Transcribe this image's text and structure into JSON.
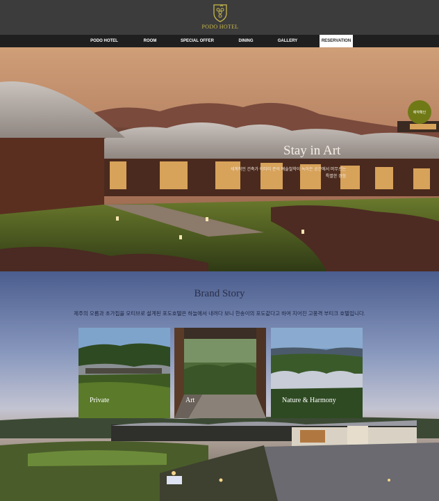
{
  "header": {
    "logo_text": "PODO HOTEL"
  },
  "nav": {
    "items": [
      "PODO HOTEL",
      "ROOM",
      "SPECIAL OFFER",
      "DINING",
      "GALLERY",
      "RESERVATION"
    ],
    "active": "RESERVATION"
  },
  "hero": {
    "title": "Stay in Art",
    "subtitle": "세계적인 건축가 이타미 준의 예술철학이 녹아든 공간에서 머무르는 특별한 경험",
    "reserve_badge": "예약확인"
  },
  "brand": {
    "title": "Brand Story",
    "description": "제주의 오름과 초가집을 모티브로 설계된 포도호텔은 하늘에서 내려다 보니 한송이의 포도같다고 하여 지어진 고풍격 부티크 호텔입니다.",
    "cards": [
      {
        "label": "Private"
      },
      {
        "label": "Art"
      },
      {
        "label": "Nature & Harmony"
      }
    ]
  },
  "colors": {
    "header_bg": "#3c3c3c",
    "nav_bg": "#1f1f1f",
    "logo_gold": "#c9b84a",
    "badge_green": "#6f7a16"
  }
}
